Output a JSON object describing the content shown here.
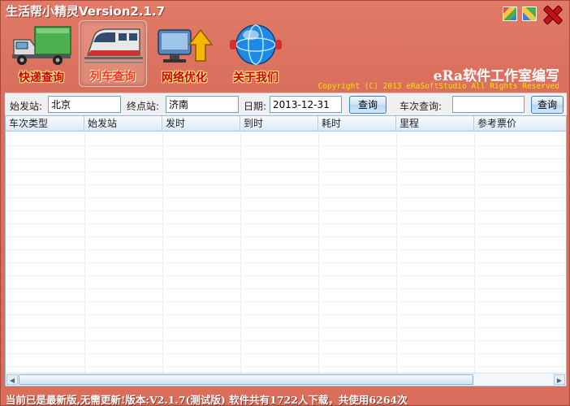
{
  "window": {
    "title": "生活帮小精灵Version2.1.7",
    "controls": [
      "color-icon",
      "palette-icon",
      "close-icon"
    ]
  },
  "toolbar": {
    "items": [
      {
        "label": "快递查询",
        "icon": "truck-icon",
        "active": false
      },
      {
        "label": "列车查询",
        "icon": "train-icon",
        "active": true
      },
      {
        "label": "网络优化",
        "icon": "network-arrow-icon",
        "active": false
      },
      {
        "label": "关于我们",
        "icon": "globe-icon",
        "active": false
      }
    ]
  },
  "brand": {
    "studio": "eRa软件工作室编写",
    "copyright": "Copyright (C) 2013 eRaSoftStudio All Rights Reserved"
  },
  "query": {
    "from_label": "始发站:",
    "from_value": "北京",
    "to_label": "终点站:",
    "to_value": "济南",
    "date_label": "日期:",
    "date_value": "2013-12-31",
    "search_label": "查询",
    "train_label": "车次查询:",
    "train_value": "",
    "train_search_label": "查询"
  },
  "grid": {
    "columns": [
      "车次类型",
      "始发站",
      "发时",
      "到时",
      "耗时",
      "里程",
      "参考票价"
    ],
    "rows": []
  },
  "status": {
    "text": "当前已是最新版,无需更新!版本:V2.1.7(测试版) 软件共有1722人下载，共使用6264次"
  },
  "colors": {
    "frame": "#d96f5c",
    "title_text": "#ffffff",
    "copyright_text": "#ffe000",
    "toolbar_label": "#d10000"
  }
}
